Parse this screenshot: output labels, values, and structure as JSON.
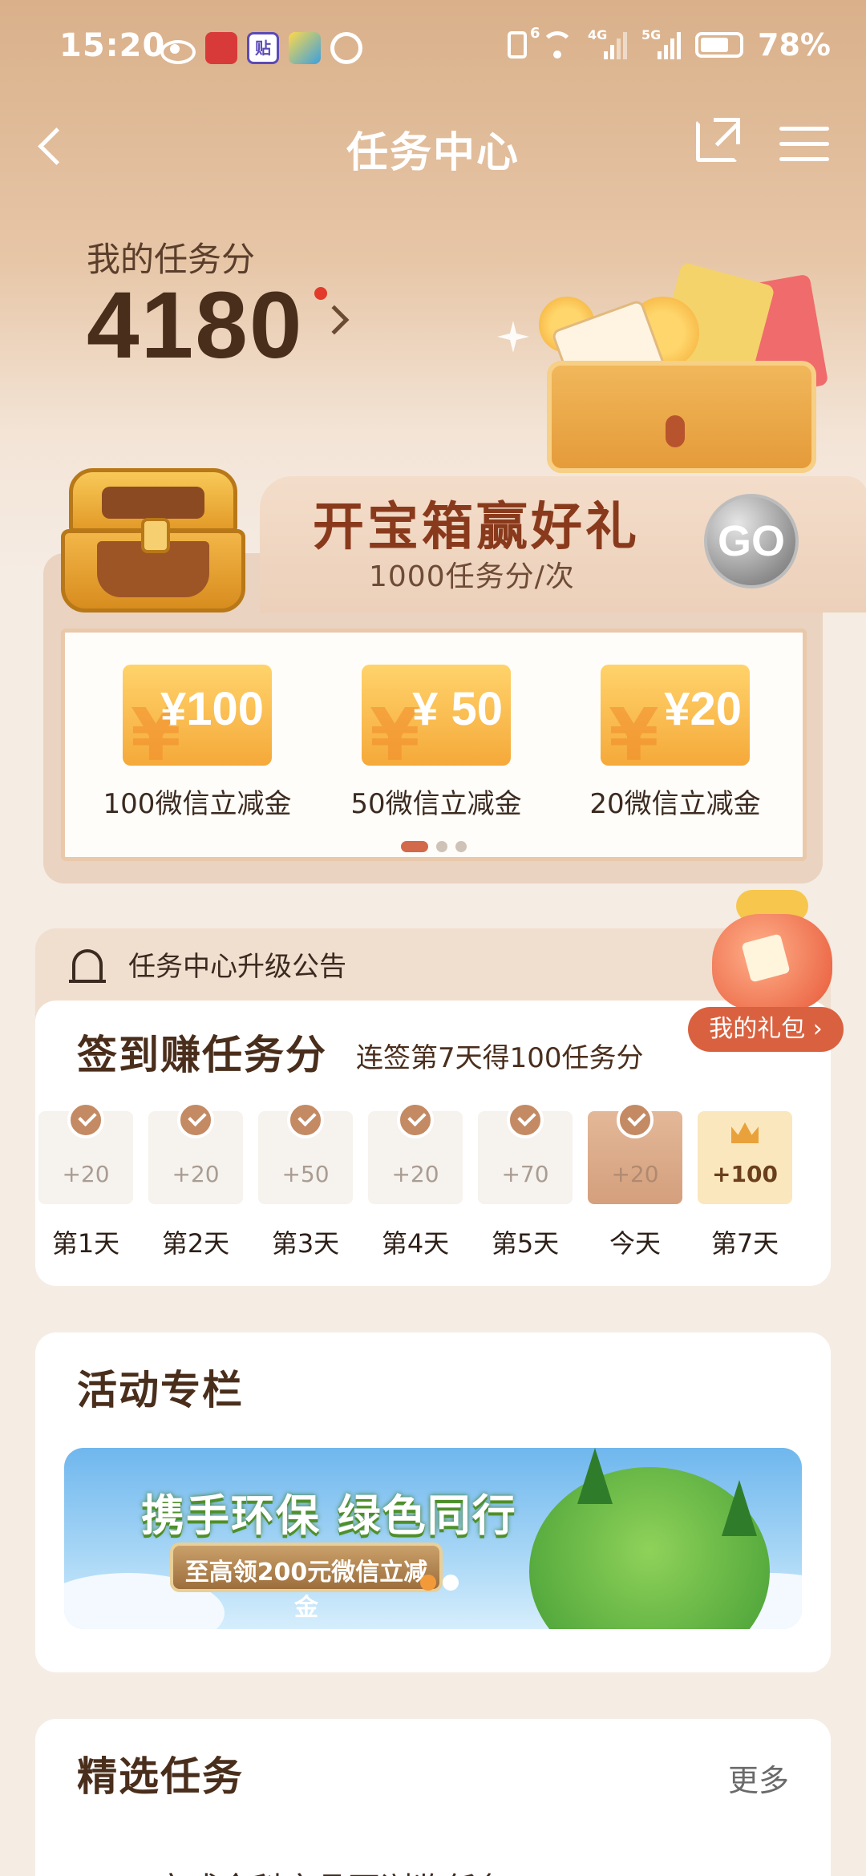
{
  "status_bar": {
    "time": "15:20",
    "sim1_label": "6",
    "sim1_network": "4G",
    "sim2_network": "5G",
    "battery": "78%",
    "app_badge": "贴"
  },
  "nav": {
    "title": "任务中心"
  },
  "score": {
    "label": "我的任务分",
    "value": "4180"
  },
  "treasure": {
    "title": "开宝箱赢好礼",
    "subtitle": "1000任务分/次",
    "go_label": "GO",
    "rewards": [
      {
        "amount": "¥100",
        "label": "100微信立减金"
      },
      {
        "amount": "¥ 50",
        "label": "50微信立减金"
      },
      {
        "amount": "¥20",
        "label": "20微信立减金"
      }
    ],
    "page_count": 3,
    "active_page": 1
  },
  "notice": {
    "text": "任务中心升级公告"
  },
  "gift": {
    "button_label": "我的礼包 ›"
  },
  "signin": {
    "title": "签到赚任务分",
    "subtitle": "连签第7天得100任务分",
    "days": [
      {
        "label": "第1天",
        "points": "+20",
        "state": "done"
      },
      {
        "label": "第2天",
        "points": "+20",
        "state": "done"
      },
      {
        "label": "第3天",
        "points": "+50",
        "state": "done"
      },
      {
        "label": "第4天",
        "points": "+20",
        "state": "done"
      },
      {
        "label": "第5天",
        "points": "+70",
        "state": "done"
      },
      {
        "label": "今天",
        "points": "+20",
        "state": "today"
      },
      {
        "label": "第7天",
        "points": "+100",
        "state": "bonus"
      }
    ]
  },
  "activity": {
    "title": "活动专栏",
    "banner_title": "携手环保 绿色同行",
    "banner_sub": "至高领200元微信立减金"
  },
  "featured": {
    "title": "精选任务",
    "more_label": "更多",
    "first_task_partial": "完成全科产品页浏览任务"
  },
  "colors": {
    "accent": "#d9613f",
    "score_text": "#4a2e1c",
    "hero_bg_top": "#d9b08a"
  }
}
